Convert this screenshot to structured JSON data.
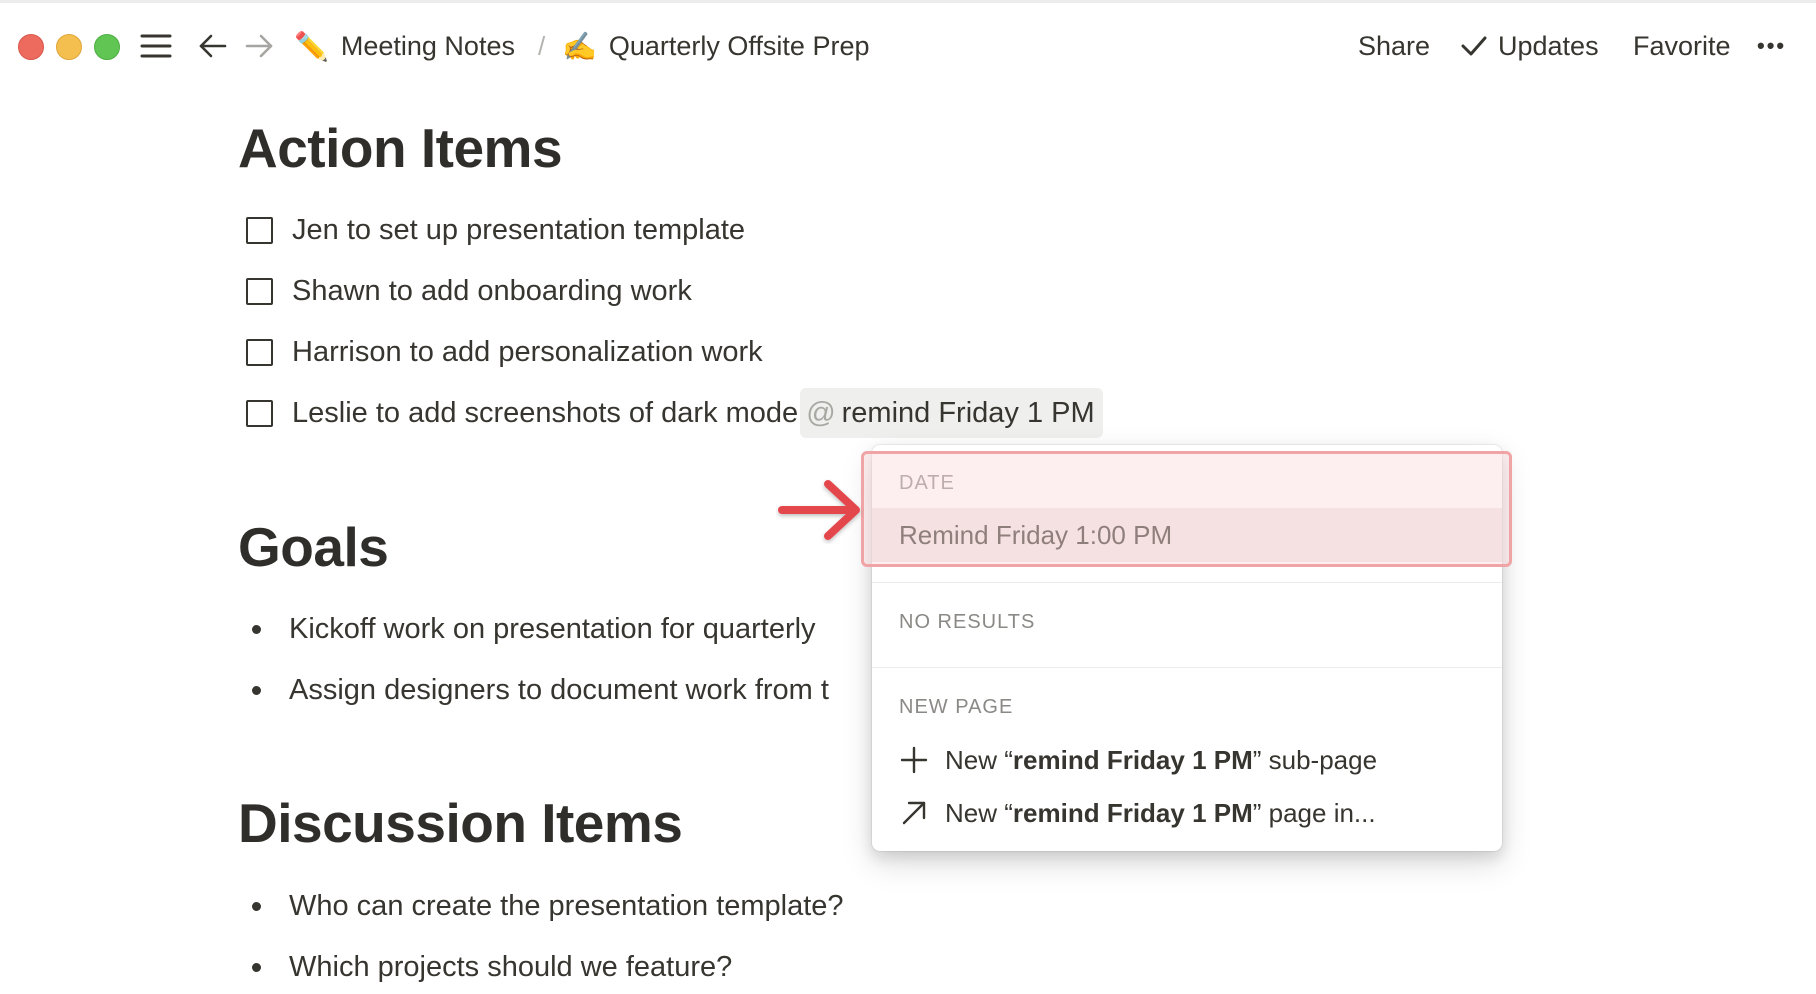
{
  "window": {
    "breadcrumb": [
      {
        "emoji": "✏️",
        "label": "Meeting Notes"
      },
      {
        "emoji": "✍️",
        "label": "Quarterly Offsite Prep"
      }
    ],
    "separator": "/",
    "actions": {
      "share": "Share",
      "updates": "Updates",
      "favorite": "Favorite",
      "more": "•••"
    }
  },
  "page": {
    "action_items": {
      "heading": "Action Items",
      "todos": [
        "Jen to set up presentation template",
        "Shawn to add onboarding work",
        "Harrison to add personalization work",
        "Leslie to add screenshots of dark mode"
      ],
      "mention": {
        "at": "@",
        "query": "remind Friday 1 PM"
      }
    },
    "goals": {
      "heading": "Goals",
      "items": [
        "Kickoff work on presentation for quarterly",
        "Assign designers to document work from t"
      ]
    },
    "discussion": {
      "heading": "Discussion Items",
      "items": [
        "Who can create the presentation template?",
        "Which projects should we feature?"
      ]
    }
  },
  "popup": {
    "date_section": "DATE",
    "date_option": "Remind Friday 1:00 PM",
    "no_results_section": "NO RESULTS",
    "new_page_section": "NEW PAGE",
    "new_subpage": {
      "prefix": "New “",
      "bold": "remind Friday 1 PM",
      "suffix": "” sub-page"
    },
    "new_page_in": {
      "prefix": "New “",
      "bold": "remind Friday 1 PM",
      "suffix": "” page in..."
    }
  },
  "colors": {
    "text": "#37352f",
    "highlight_border": "#f0a4a6",
    "arrow": "#e4474c",
    "selected_row": "#f1e8e5"
  }
}
